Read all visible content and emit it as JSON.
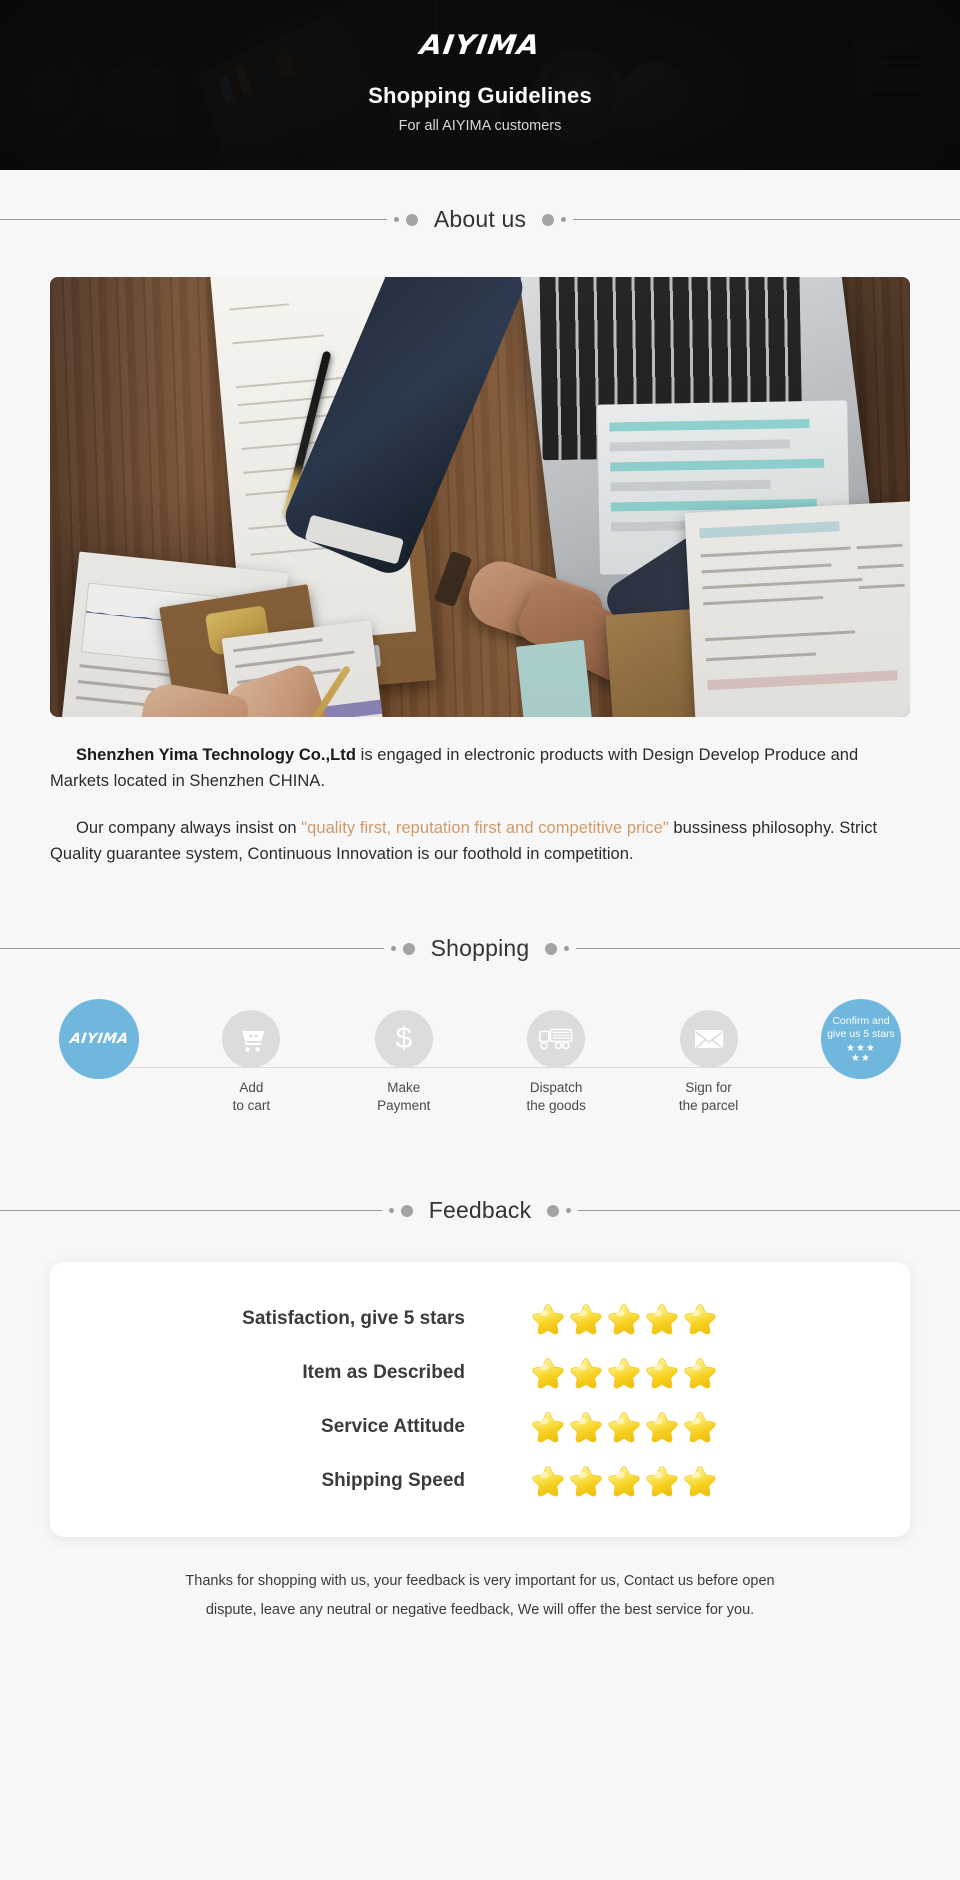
{
  "hero": {
    "brand": "AIYIMA",
    "title": "Shopping Guidelines",
    "subtitle": "For all AIYIMA customers"
  },
  "sections": {
    "about_title": "About us",
    "shopping_title": "Shopping",
    "feedback_title": "Feedback"
  },
  "about": {
    "paragraph1_company": "Shenzhen Yima Technology Co.,Ltd",
    "paragraph1_rest": " is engaged in electronic products with Design Develop Produce and Markets located in Shenzhen CHINA.",
    "paragraph2_pre": "Our company always insist on ",
    "paragraph2_quote": "\"quality first, reputation first and competitive price\"",
    "paragraph2_post": " bussiness philosophy. Strict Quality guarantee system, Continuous Innovation is our foothold in competition."
  },
  "shopping_steps": [
    {
      "id": "aiyima",
      "icon": "aiyima-logo",
      "label": "",
      "label_line1": "",
      "label_line2": "",
      "style": "brand"
    },
    {
      "id": "add-to-cart",
      "icon": "shopping-cart-icon",
      "label_line1": "Add",
      "label_line2": "to cart",
      "style": "grey"
    },
    {
      "id": "make-payment",
      "icon": "dollar-icon",
      "label_line1": "Make",
      "label_line2": "Payment",
      "style": "grey"
    },
    {
      "id": "dispatch-goods",
      "icon": "truck-icon",
      "label_line1": "Dispatch",
      "label_line2": "the goods",
      "style": "grey"
    },
    {
      "id": "sign-parcel",
      "icon": "envelope-icon",
      "label_line1": "Sign for",
      "label_line2": "the parcel",
      "style": "grey"
    },
    {
      "id": "confirm-5-stars",
      "icon": "five-stars-icon",
      "confirm_line1": "Confirm and",
      "confirm_line2": "give us 5 stars",
      "stars_row1": "★★★",
      "stars_row2": "★★",
      "style": "blue"
    }
  ],
  "feedback_rows": [
    {
      "label": "Satisfaction, give 5 stars",
      "stars": 5
    },
    {
      "label": "Item as Described",
      "stars": 5
    },
    {
      "label": "Service Attitude",
      "stars": 5
    },
    {
      "label": "Shipping Speed",
      "stars": 5
    }
  ],
  "footer": {
    "line1": "Thanks for shopping with us, your feedback is very important for us, Contact us before open",
    "line2": "dispute, leave any neutral or negative feedback, We will offer the best service for you."
  },
  "colors": {
    "brand_blue": "#6fb7dc",
    "accent_orange": "#d19a6a",
    "star_gold": "#f7d33c",
    "header_bg": "#151515",
    "page_bg": "#f7f7f7"
  }
}
